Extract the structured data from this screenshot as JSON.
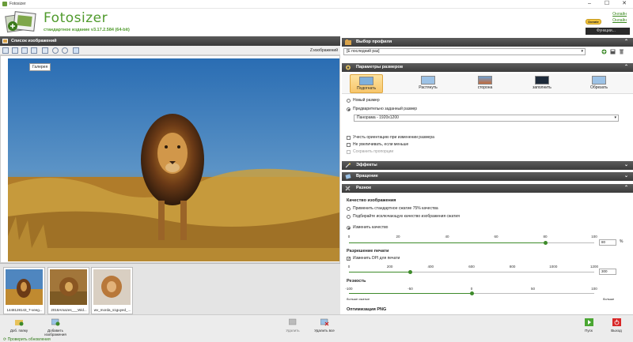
{
  "window": {
    "title": "Fotosizer"
  },
  "header": {
    "app_name": "Fotosizer",
    "edition": "стандартное издание    v3.17.2.584    (64-bit)",
    "online_link": "Онлайн",
    "settings_link": "Онлайн",
    "donate": "Donate",
    "functions": "Функции..."
  },
  "left": {
    "title": "Список изображений",
    "zoom_label": "Z:изображений",
    "tooltip": "Галерея",
    "thumbnails": [
      {
        "caption": "1448128143_7-veeg..."
      },
      {
        "caption": "2018Amazes___Wid..."
      },
      {
        "caption": "wv_morda_s1guyed_..."
      }
    ]
  },
  "right": {
    "profile": {
      "title": "Выбор профиля",
      "value": "[Е последний раз]"
    },
    "size": {
      "title": "Параметры размеров",
      "modes": [
        "Подогнать",
        "Растянуть",
        "сторона",
        "заполнить",
        "Обрезать"
      ],
      "opt_new_size": "Новый размер",
      "opt_predefined": "Предварительно заданный размер",
      "preset": "Панорама - 1920x1200",
      "chk_orientation": "Учесть ориентацию при изменении размера",
      "chk_no_enlarge": "Не увеличивать, если меньше",
      "chk_keep_ratio": "Сохранить пропорции"
    },
    "effects": {
      "title": "Эффекты"
    },
    "rotation": {
      "title": "Вращение"
    },
    "misc": {
      "title": "Разное"
    },
    "quality": {
      "title": "Качество изображения",
      "opt_default": "Применить стандартное сжатие 75% качества",
      "opt_match": "Подбирайте исключающую качество изображения сжатия",
      "opt_change": "Изменить качество",
      "ticks": [
        "0",
        "20",
        "40",
        "60",
        "80",
        "100"
      ],
      "value": "80",
      "unit": "%"
    },
    "print": {
      "title": "Разрешение печати",
      "chk_dpi": "Изменить DPI для печати",
      "ticks": [
        "0",
        "200",
        "400",
        "600",
        "800",
        "1000",
        "1200"
      ],
      "value": "300"
    },
    "sharpness": {
      "title": "Резкость",
      "ticks": [
        "-100",
        "-50",
        "0",
        "50",
        "100"
      ],
      "low_label": "больше сжатые",
      "high_label": "больше",
      "value": 0
    },
    "png": {
      "title": "Оптимизация PNG"
    }
  },
  "bottom": {
    "add_folder": "Доб. папку",
    "add_images": "Добавить изображения",
    "delete": "Удалить",
    "delete_all": "Удалить все",
    "start": "Пуск",
    "exit": "Выход",
    "check_updates": "Проверить обновления"
  },
  "levels": {
    "quality": 0.8,
    "dpi": 0.25,
    "sharpness": 0.5
  }
}
